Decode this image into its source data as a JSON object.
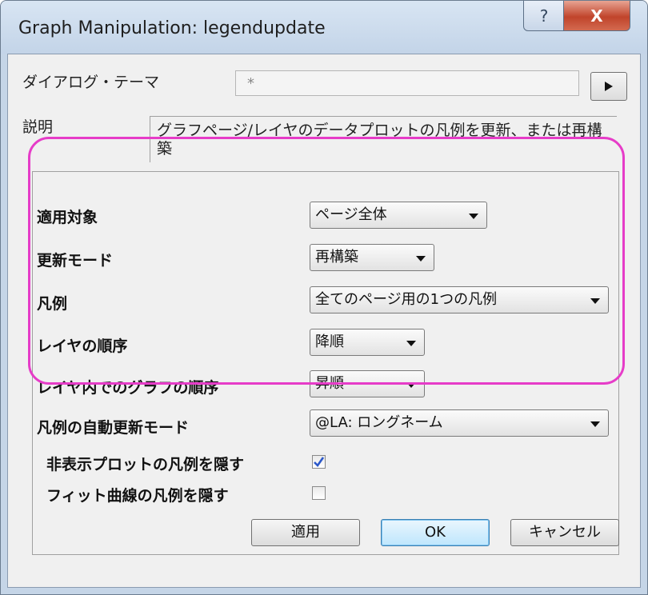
{
  "window": {
    "title": "Graph Manipulation: legendupdate"
  },
  "titlebar": {
    "help_label": "?",
    "close_label": "X"
  },
  "dialog_theme": {
    "label": "ダイアログ・テーマ",
    "value": "*"
  },
  "description": {
    "label": "説明",
    "text": "グラフページ/レイヤのデータプロットの凡例を更新、または再構築"
  },
  "options": [
    {
      "label": "適用対象",
      "value": "ページ全体"
    },
    {
      "label": "更新モード",
      "value": "再構築"
    },
    {
      "label": "凡例",
      "value": "全てのページ用の1つの凡例"
    },
    {
      "label": "レイヤの順序",
      "value": "降順"
    },
    {
      "label": "レイヤ内でのグラフの順序",
      "value": "昇順"
    },
    {
      "label": "凡例の自動更新モード",
      "value": "@LA: ロングネーム"
    }
  ],
  "checkboxes": [
    {
      "label": "非表示プロットの凡例を隠す",
      "checked": true
    },
    {
      "label": "フィット曲線の凡例を隠す",
      "checked": false
    }
  ],
  "buttons": {
    "apply": "適用",
    "ok": "OK",
    "cancel": "キャンセル"
  },
  "colors": {
    "highlight": "#e63cc8",
    "check": "#2b58c9"
  }
}
